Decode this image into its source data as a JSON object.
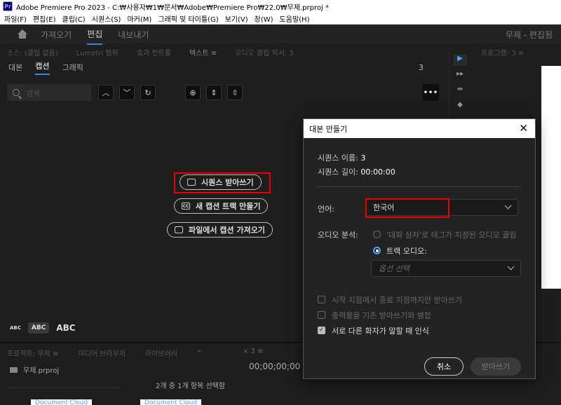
{
  "titlebar": {
    "app_badge": "Pr",
    "title": "Adobe Premiere Pro 2023 - C:₩사용자₩1₩문서₩Adobe₩Premiere Pro₩22.0₩무제.prproj *"
  },
  "menu": [
    "파일(F)",
    "편집(E)",
    "클립(C)",
    "시퀀스(S)",
    "마커(M)",
    "그래픽 및 타이틀(G)",
    "보기(V)",
    "창(W)",
    "도움말(H)"
  ],
  "workspace": {
    "tabs": [
      "가져오기",
      "편집",
      "내보내기"
    ],
    "active": "편집",
    "right_title": "무제 - 편집됨"
  },
  "panel_tabs": [
    "소스: (클립 없음)",
    "Lumetri 범위",
    "효과 컨트롤",
    "텍스트  ≡",
    "오디오 클립 믹서: 3"
  ],
  "sub_tabs": {
    "items": [
      "대본",
      "캡션",
      "그래픽"
    ],
    "active": "캡션",
    "count": "3"
  },
  "toolbar": {
    "search_placeholder": "검색",
    "more": "•••"
  },
  "actions": {
    "transcribe": "시퀀스 받아쓰기",
    "new_caption_track": "새 캡션 트랙 만들기",
    "import_captions": "파일에서 캡션 가져오기",
    "cc_badge": "CC"
  },
  "abc": [
    "ABC",
    "ABC",
    "ABC"
  ],
  "program": {
    "title": "프로그램: 3  ≡"
  },
  "bottom": {
    "tabs": [
      "프로젝트: 무제  ≡",
      "미디어 브라우저",
      "라이브러리",
      "»"
    ],
    "project_file": "무제.prproj",
    "selection": "2개 중 1개 항목 선택함",
    "thumb1": "Document Cloud",
    "thumb2": "Document Cloud",
    "timeline_tab": "×  3  ≡",
    "timecode": "00;00;00;00"
  },
  "dialog": {
    "title": "대본 만들기",
    "close": "✕",
    "sequence_name_label": "시퀀스 이름:",
    "sequence_name": "3",
    "sequence_length_label": "시퀀스 길이:",
    "sequence_length": "00:00:00",
    "language_label": "언어:",
    "language_value": "한국어",
    "audio_label": "오디오 분석:",
    "audio_opt1": "'대화 상자'로 태그가 지정된 오디오 클립",
    "audio_opt2": "트랙 오디오:",
    "audio_select": "옵션 선택",
    "check1": "시작 지점에서 종료 지점까지만 받아쓰기",
    "check2": "출력물을 기존 받아쓰기와 병합",
    "check3": "서로 다른 화자가 말할 때 인식",
    "cancel": "취소",
    "transcribe": "받아쓰기"
  },
  "colors": {
    "accent": "#2d8ceb",
    "highlight_box": "#e00000"
  }
}
